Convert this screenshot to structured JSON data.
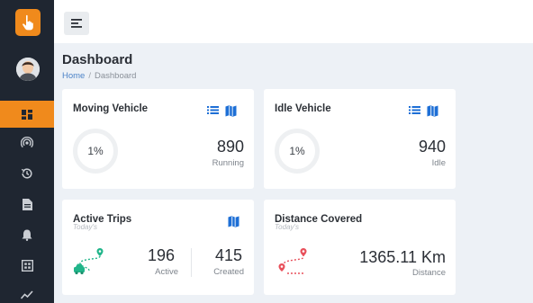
{
  "colors": {
    "sidebar": "#1f2631",
    "accent": "#f08a1c",
    "link": "#4d84c8",
    "icon_blue": "#1d6fd6",
    "trip_green": "#21b58a",
    "distance_red": "#e8505b"
  },
  "sidebar": {
    "items": [
      {
        "icon": "dashboard-icon",
        "active": true
      },
      {
        "icon": "live-tracking-icon"
      },
      {
        "icon": "history-icon"
      },
      {
        "icon": "document-icon"
      },
      {
        "icon": "bell-icon"
      },
      {
        "icon": "calendar-icon"
      },
      {
        "icon": "chart-icon"
      }
    ]
  },
  "header": {
    "title": "Dashboard",
    "breadcrumb": [
      "Home",
      "Dashboard"
    ],
    "breadcrumb_sep": "/"
  },
  "cards": {
    "moving": {
      "title": "Moving Vehicle",
      "percent": "1%",
      "value": "890",
      "label": "Running"
    },
    "idle": {
      "title": "Idle Vehicle",
      "percent": "1%",
      "value": "940",
      "label": "Idle"
    },
    "trips": {
      "title": "Active Trips",
      "subtitle": "Today's",
      "active_value": "196",
      "active_label": "Active",
      "created_value": "415",
      "created_label": "Created"
    },
    "distance": {
      "title": "Distance Covered",
      "subtitle": "Today's",
      "value": "1365.11 Km",
      "label": "Distance"
    }
  }
}
